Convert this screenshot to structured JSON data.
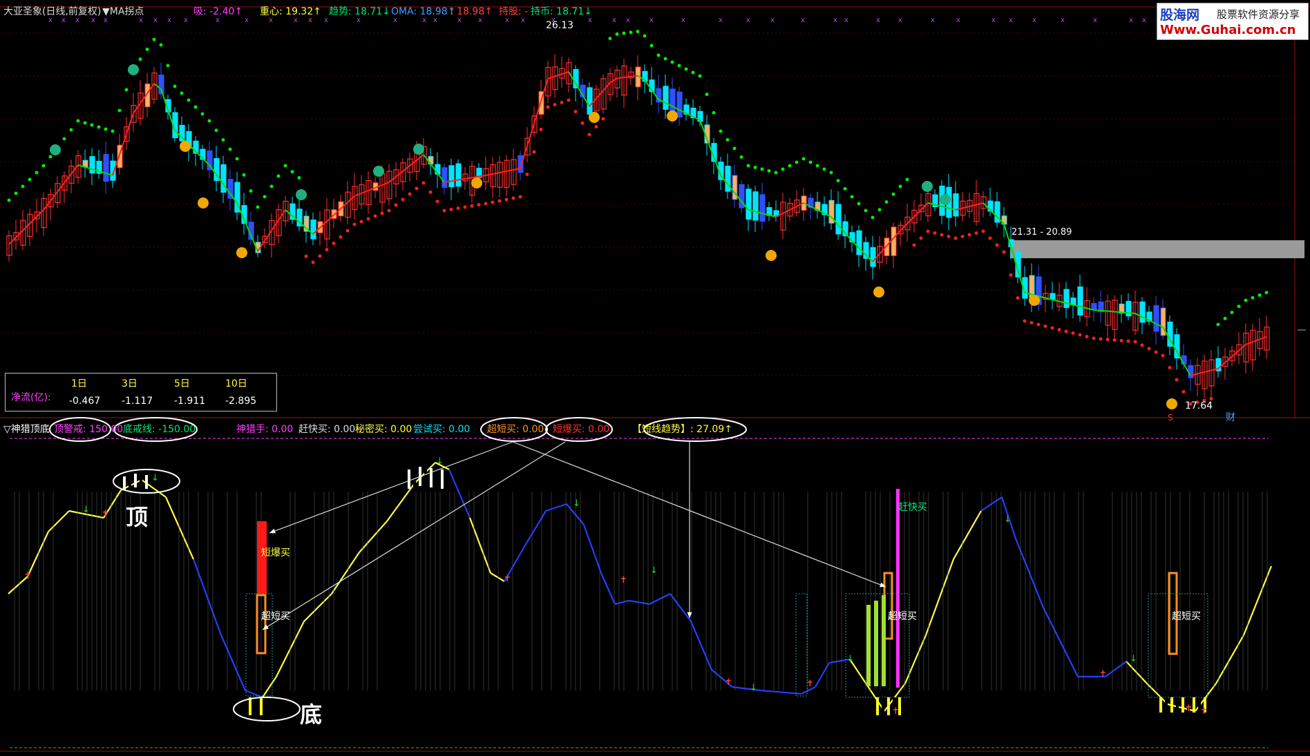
{
  "main_header": {
    "title": "大亚圣象(日线,前复权)",
    "ma_label": "▼MA拐点",
    "xi": "吸: -2.40↑",
    "zhongxin": "重心: 19.32↑",
    "qushi": "趋势: 18.71↓",
    "oma": "OMA: 18.98↑",
    "val2": ": 18.98↑",
    "chigu": "持股: -",
    "chibi": "持币: 18.71↓"
  },
  "price_labels": {
    "high": "26.13",
    "low": "17.64",
    "range": "21.31 - 20.89",
    "s_mark": "S",
    "cai_mark": "财"
  },
  "net_flow": {
    "label": "净流(亿):",
    "headers": [
      "1日",
      "3日",
      "5日",
      "10日"
    ],
    "values": [
      "-0.467",
      "-1.117",
      "-1.911",
      "-2.895"
    ]
  },
  "sub_header": {
    "name": "▽神猎顶底",
    "top_warn": "顶警戒: 150.00",
    "bottom_warn": "底戒线: -150.00",
    "shen_lie": "神猎手: 0.00",
    "gan_kuai": "赶快买: 0.00",
    "mi_mi": "秘密买: 0.00",
    "chang_shi": "尝试买: 0.00",
    "chao_duan": "超短买: 0.00",
    "duan_bao": "短爆买: 0.00",
    "duan_xian": "【短线趋势】: 27.09↑"
  },
  "annotations": {
    "ding": "顶",
    "di": "底",
    "duan_bao_buy": "短爆买",
    "chao_duan_buy": "超短买",
    "gan_kuai_buy": "赶快买"
  },
  "watermark": {
    "brand": "股海网",
    "sub": "股票软件资源分享",
    "url": "Www.Guhai.com.cn"
  },
  "colors": {
    "up": "#ff3030",
    "down": "#00e5ff",
    "ma_up": "#ff2020",
    "ma_down": "#00dd00",
    "osc_up": "#ffff40",
    "osc_down": "#2040ff",
    "accent_magenta": "#ff40ff"
  }
}
